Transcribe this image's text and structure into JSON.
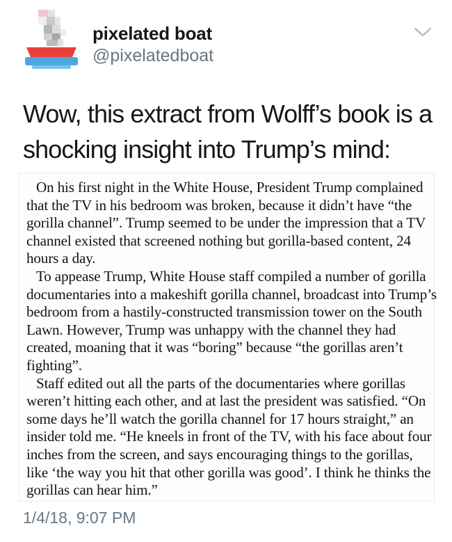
{
  "user": {
    "display_name": "pixelated boat",
    "handle": "@pixelatedboat",
    "avatar_icon": "pixel-boat-icon"
  },
  "menu_icon": "chevron-down-icon",
  "tweet": {
    "text": "Wow, this extract from Wolff’s book is a shocking insight into Trump’s mind:",
    "timestamp": "1/4/18, 9:07 PM"
  },
  "media": {
    "paragraphs": [
      "On his first night in the White House, President Trump complained that the TV in his bedroom was broken, because it didn’t have “the gorilla channel”. Trump seemed to be under the impression that a TV channel existed that screened nothing but gorilla-based content, 24 hours a day.",
      "To appease Trump, White House staff compiled a number of gorilla documentaries into a makeshift gorilla channel, broadcast into Trump’s bedroom from a hastily-constructed transmission tower on the South Lawn. However, Trump was unhappy with the channel they had created, moaning that it was “boring” because “the gorillas aren’t fighting”.",
      "Staff edited out all the parts of the documentaries where gorillas weren’t hitting each other, and at last the president was satisfied. “On some days he’ll watch the gorilla channel for 17 hours straight,” an insider told me. “He kneels in front of the TV, with his face about four inches from the screen, and says encouraging things to the gorillas, like ‘the way you hit that other gorilla was good’. I think he thinks the gorillas can hear him.”"
    ]
  },
  "colors": {
    "text": "#14171a",
    "secondary": "#657786",
    "boat_red": "#e8413a",
    "boat_blue": "#4da8e0"
  }
}
